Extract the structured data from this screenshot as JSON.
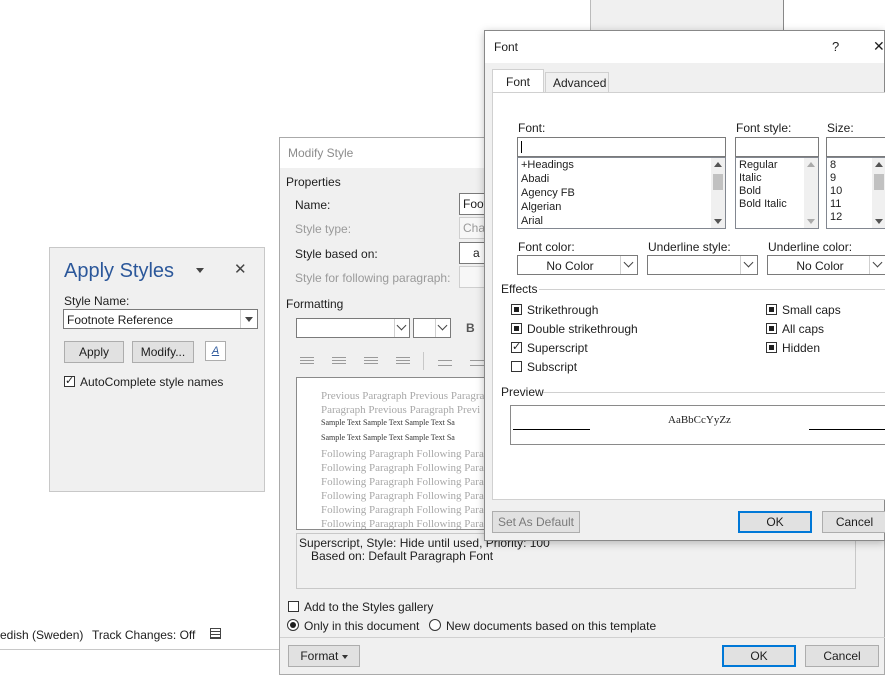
{
  "status_bar": {
    "language": "edish (Sweden)",
    "track_changes": "Track Changes: Off"
  },
  "apply_styles": {
    "title": "Apply Styles",
    "style_name_label": "Style Name:",
    "style_name_value": "Footnote Reference",
    "apply_button": "Apply",
    "modify_button": "Modify...",
    "autocomplete_label": "AutoComplete style names",
    "autocomplete_checked": true
  },
  "modify_style": {
    "title": "Modify Style",
    "properties_label": "Properties",
    "name_label": "Name:",
    "name_value": "Foot",
    "style_type_label": "Style type:",
    "style_type_value": "Cha",
    "based_on_label": "Style based on:",
    "based_on_value": "a",
    "following_label": "Style for following paragraph:",
    "formatting_label": "Formatting",
    "bold_label": "B",
    "preview_prev_1": "Previous Paragraph Previous Paragra",
    "preview_prev_2": "Paragraph Previous Paragraph Previ",
    "preview_sample_1": "Sample Text Sample Text Sample Text Sa",
    "preview_sample_2": "Sample Text Sample Text Sample Text Sa",
    "preview_following": [
      "Following Paragraph Following Para",
      "Following Paragraph Following Para",
      "Following Paragraph Following Para",
      "Following Paragraph Following Para",
      "Following Paragraph Following Para",
      "Following Paragraph Following Para"
    ],
    "description_line1": "Superscript, Style: Hide until used, Priority: 100",
    "description_line2": "Based on: Default Paragraph Font",
    "add_gallery_label": "Add to the Styles gallery",
    "only_doc_label": "Only in this document",
    "new_docs_label": "New documents based on this template",
    "format_button": "Format",
    "ok_button": "OK",
    "cancel_button": "Cancel"
  },
  "font_dialog": {
    "title": "Font",
    "help": "?",
    "close": "✕",
    "tab_font": "Font",
    "tab_advanced": "Advanced",
    "font_label": "Font:",
    "font_value": "",
    "font_list": [
      "+Headings",
      "Abadi",
      "Agency FB",
      "Algerian",
      "Arial"
    ],
    "style_label": "Font style:",
    "style_list": [
      "Regular",
      "Italic",
      "Bold",
      "Bold Italic"
    ],
    "size_label": "Size:",
    "size_list": [
      "8",
      "9",
      "10",
      "11",
      "12"
    ],
    "font_color_label": "Font color:",
    "font_color_value": "No Color",
    "underline_style_label": "Underline style:",
    "underline_color_label": "Underline color:",
    "underline_color_value": "No Color",
    "effects_label": "Effects",
    "effects_left": [
      {
        "label": "Strikethrough",
        "state": "mixed"
      },
      {
        "label": "Double strikethrough",
        "state": "mixed"
      },
      {
        "label": "Superscript",
        "state": "checked"
      },
      {
        "label": "Subscript",
        "state": "unchecked"
      }
    ],
    "effects_right": [
      {
        "label": "Small caps",
        "state": "mixed"
      },
      {
        "label": "All caps",
        "state": "mixed"
      },
      {
        "label": "Hidden",
        "state": "mixed"
      }
    ],
    "preview_label": "Preview",
    "preview_text": "AaBbCcYyZz",
    "set_default_button": "Set As Default",
    "ok_button": "OK",
    "cancel_button": "Cancel"
  }
}
